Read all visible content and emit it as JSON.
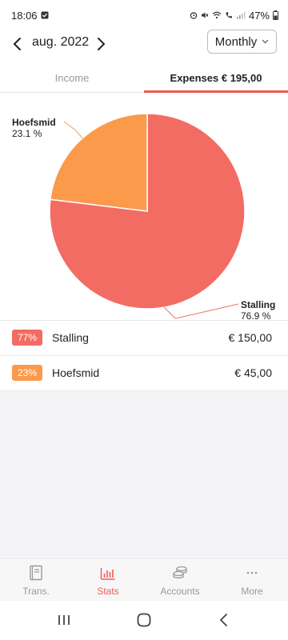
{
  "status_bar": {
    "time": "18:06",
    "battery": "47%"
  },
  "header": {
    "month": "aug. 2022",
    "period": "Monthly"
  },
  "tabs": {
    "income": "Income",
    "expenses": "Expenses  € 195,00",
    "active": "expenses"
  },
  "colors": {
    "accent": "#ee5b55",
    "stalling": "#f26c63",
    "hoefsmid": "#fb9a4b"
  },
  "chart_data": {
    "type": "pie",
    "slices": [
      {
        "name": "Stalling",
        "value": 150.0,
        "percent": 76.9,
        "label": "76.9 %"
      },
      {
        "name": "Hoefsmid",
        "value": 45.0,
        "percent": 23.1,
        "label": "23.1 %"
      }
    ]
  },
  "list": [
    {
      "badge": "77%",
      "name": "Stalling",
      "amount": "€ 150,00"
    },
    {
      "badge": "23%",
      "name": "Hoefsmid",
      "amount": "€ 45,00"
    }
  ],
  "nav": {
    "trans": "Trans.",
    "stats": "Stats",
    "accounts": "Accounts",
    "more": "More"
  }
}
